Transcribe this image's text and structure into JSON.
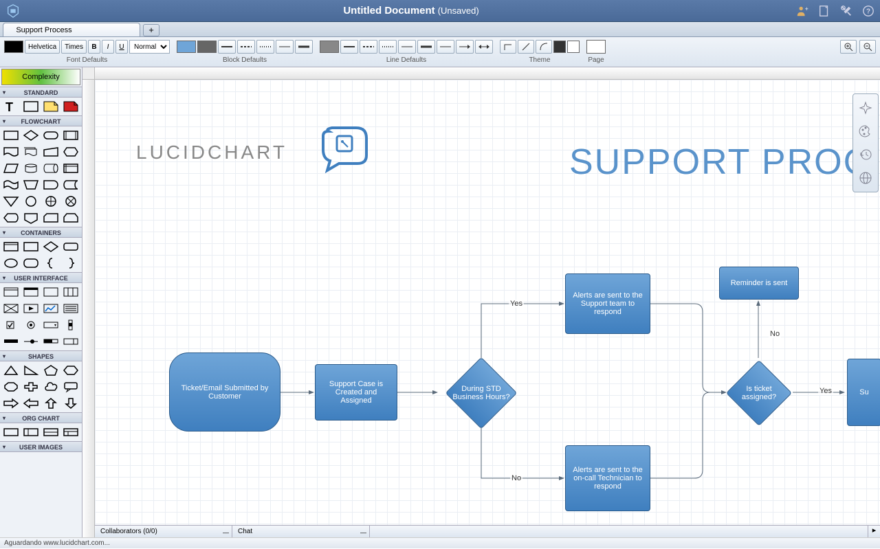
{
  "titlebar": {
    "title": "Untitled Document",
    "status": "(Unsaved)"
  },
  "tabs": [
    {
      "label": "Support Process"
    }
  ],
  "toolbar": {
    "font_defaults": "Font Defaults",
    "block_defaults": "Block Defaults",
    "line_defaults": "Line Defaults",
    "theme": "Theme",
    "page": "Page",
    "font1": "Helvetica",
    "font2": "Times",
    "bold": "B",
    "italic": "I",
    "underline": "U",
    "style_sel": "Normal",
    "font_color": "#000000",
    "block_fill": "#6fa5d8",
    "block_border": "#666666",
    "line_color": "#888888",
    "theme_fill": "#888888",
    "page_fill": "#ffffff"
  },
  "sidebar": {
    "complexity": "Complexity",
    "sections": {
      "standard": "STANDARD",
      "flowchart": "FLOWCHART",
      "containers": "CONTAINERS",
      "ui": "USER INTERFACE",
      "shapes": "SHAPES",
      "orgchart": "ORG CHART",
      "userimages": "USER IMAGES"
    }
  },
  "canvas": {
    "logo_text": "LUCIDCHART",
    "big_title": "SUPPORT PROC",
    "nodes": {
      "start": "Ticket/Email Submitted by Customer",
      "case": "Support Case is Created and Assigned",
      "hours": "During STD Business Hours?",
      "alerts_team": "Alerts are sent to the Support team to respond",
      "alerts_oncall": "Alerts are sent to the on-call Technician to respond",
      "assigned": "Is ticket assigned?",
      "reminder": "Reminder is sent",
      "su": "Su"
    },
    "labels": {
      "yes": "Yes",
      "no": "No"
    }
  },
  "bottom": {
    "collab": "Collaborators (0/0)",
    "chat": "Chat"
  },
  "status": "Aguardando www.lucidchart.com..."
}
